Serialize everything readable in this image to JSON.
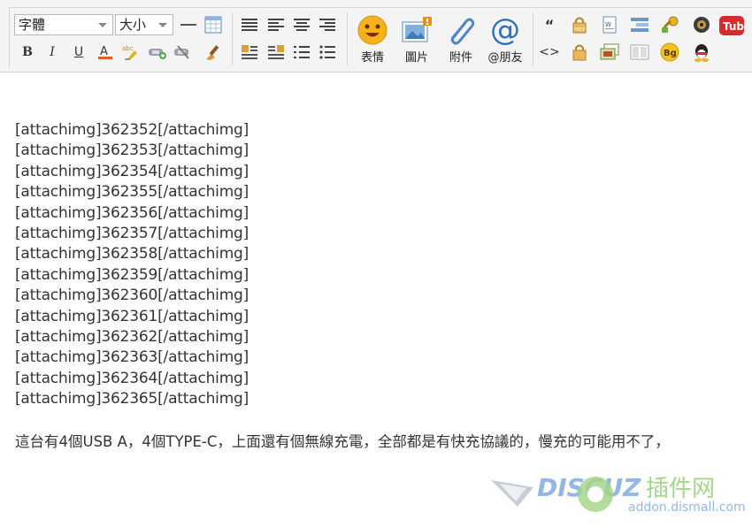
{
  "toolbar": {
    "font_select": "字體",
    "size_select": "大小",
    "big_buttons": [
      {
        "name": "emoji-button",
        "label": "表情"
      },
      {
        "name": "image-button",
        "label": "圖片"
      },
      {
        "name": "attachment-button",
        "label": "附件"
      },
      {
        "name": "mention-button",
        "label": "@朋友"
      }
    ],
    "icons_row1": [
      "horizontal-rule-icon",
      "table-icon",
      "align-justify-icon",
      "align-left-icon",
      "align-center-icon",
      "align-right-icon",
      "quote-icon",
      "free-icon",
      "word-icon",
      "float-icon",
      "password-key-icon",
      "media-icon",
      "youtube-icon"
    ],
    "icons_row2": [
      "bold-icon",
      "italic-icon",
      "underline-icon",
      "font-color-icon",
      "highlight-icon",
      "link-icon",
      "unlink-icon",
      "clear-format-icon",
      "float-left-icon",
      "float-right-icon",
      "ordered-list-icon",
      "unordered-list-icon",
      "code-icon",
      "hide-icon",
      "image-insert-icon",
      "column-icon",
      "background-icon",
      "qq-icon"
    ],
    "youtube_text": "Tube",
    "bg_text": "Bg"
  },
  "content": {
    "lines": [
      "[attachimg]362352[/attachimg]",
      "[attachimg]362353[/attachimg]",
      "[attachimg]362354[/attachimg]",
      "[attachimg]362355[/attachimg]",
      "[attachimg]362356[/attachimg]",
      "[attachimg]362357[/attachimg]",
      "[attachimg]362358[/attachimg]",
      "[attachimg]362359[/attachimg]",
      "[attachimg]362360[/attachimg]",
      "[attachimg]362361[/attachimg]",
      "[attachimg]362362[/attachimg]",
      "[attachimg]362363[/attachimg]",
      "[attachimg]362364[/attachimg]",
      "[attachimg]362365[/attachimg]"
    ],
    "paragraph": "這台有4個USB A，4個TYPE-C，上面還有個無線充電，全部都是有快充協議的，慢充的可能用不了，"
  },
  "watermark": {
    "brand": "DISCUZ",
    "cn": "插件网",
    "domain": "addon.dismall.com"
  },
  "colors": {
    "toolbar_bg": "#f4f4f4",
    "text": "#333333",
    "watermark_blue": "#3a7bd5",
    "watermark_green": "#5ab52e"
  }
}
